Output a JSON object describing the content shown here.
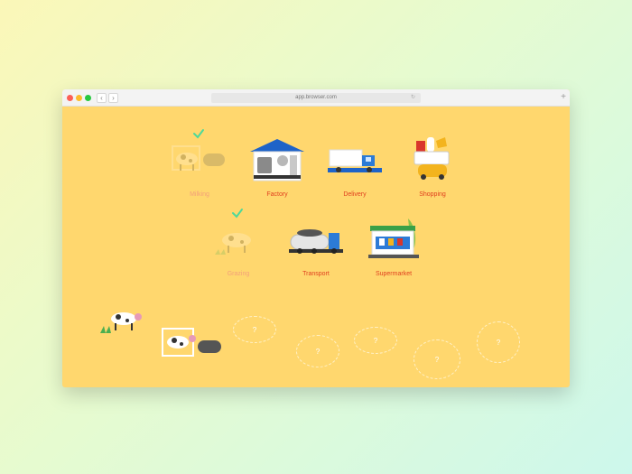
{
  "browser": {
    "url": "app.browser.com",
    "back_glyph": "‹",
    "forward_glyph": "›",
    "new_tab_glyph": "+",
    "reload_glyph": "↻"
  },
  "flow": {
    "row1": [
      {
        "label": "Milking",
        "state": "done"
      },
      {
        "label": "Factory",
        "state": "active"
      },
      {
        "label": "Delivery",
        "state": "active"
      },
      {
        "label": "Shopping",
        "state": "active"
      }
    ],
    "row2": [
      {
        "label": "Grazing",
        "state": "done"
      },
      {
        "label": "Transport",
        "state": "active"
      },
      {
        "label": "Supermarket",
        "state": "active"
      }
    ]
  },
  "slots": [
    "?",
    "?",
    "?",
    "?",
    "?"
  ],
  "colors": {
    "stage_bg": "#ffd76e",
    "label": "#e0401f",
    "label_done": "#f3a07a",
    "check": "#4cd99a"
  }
}
